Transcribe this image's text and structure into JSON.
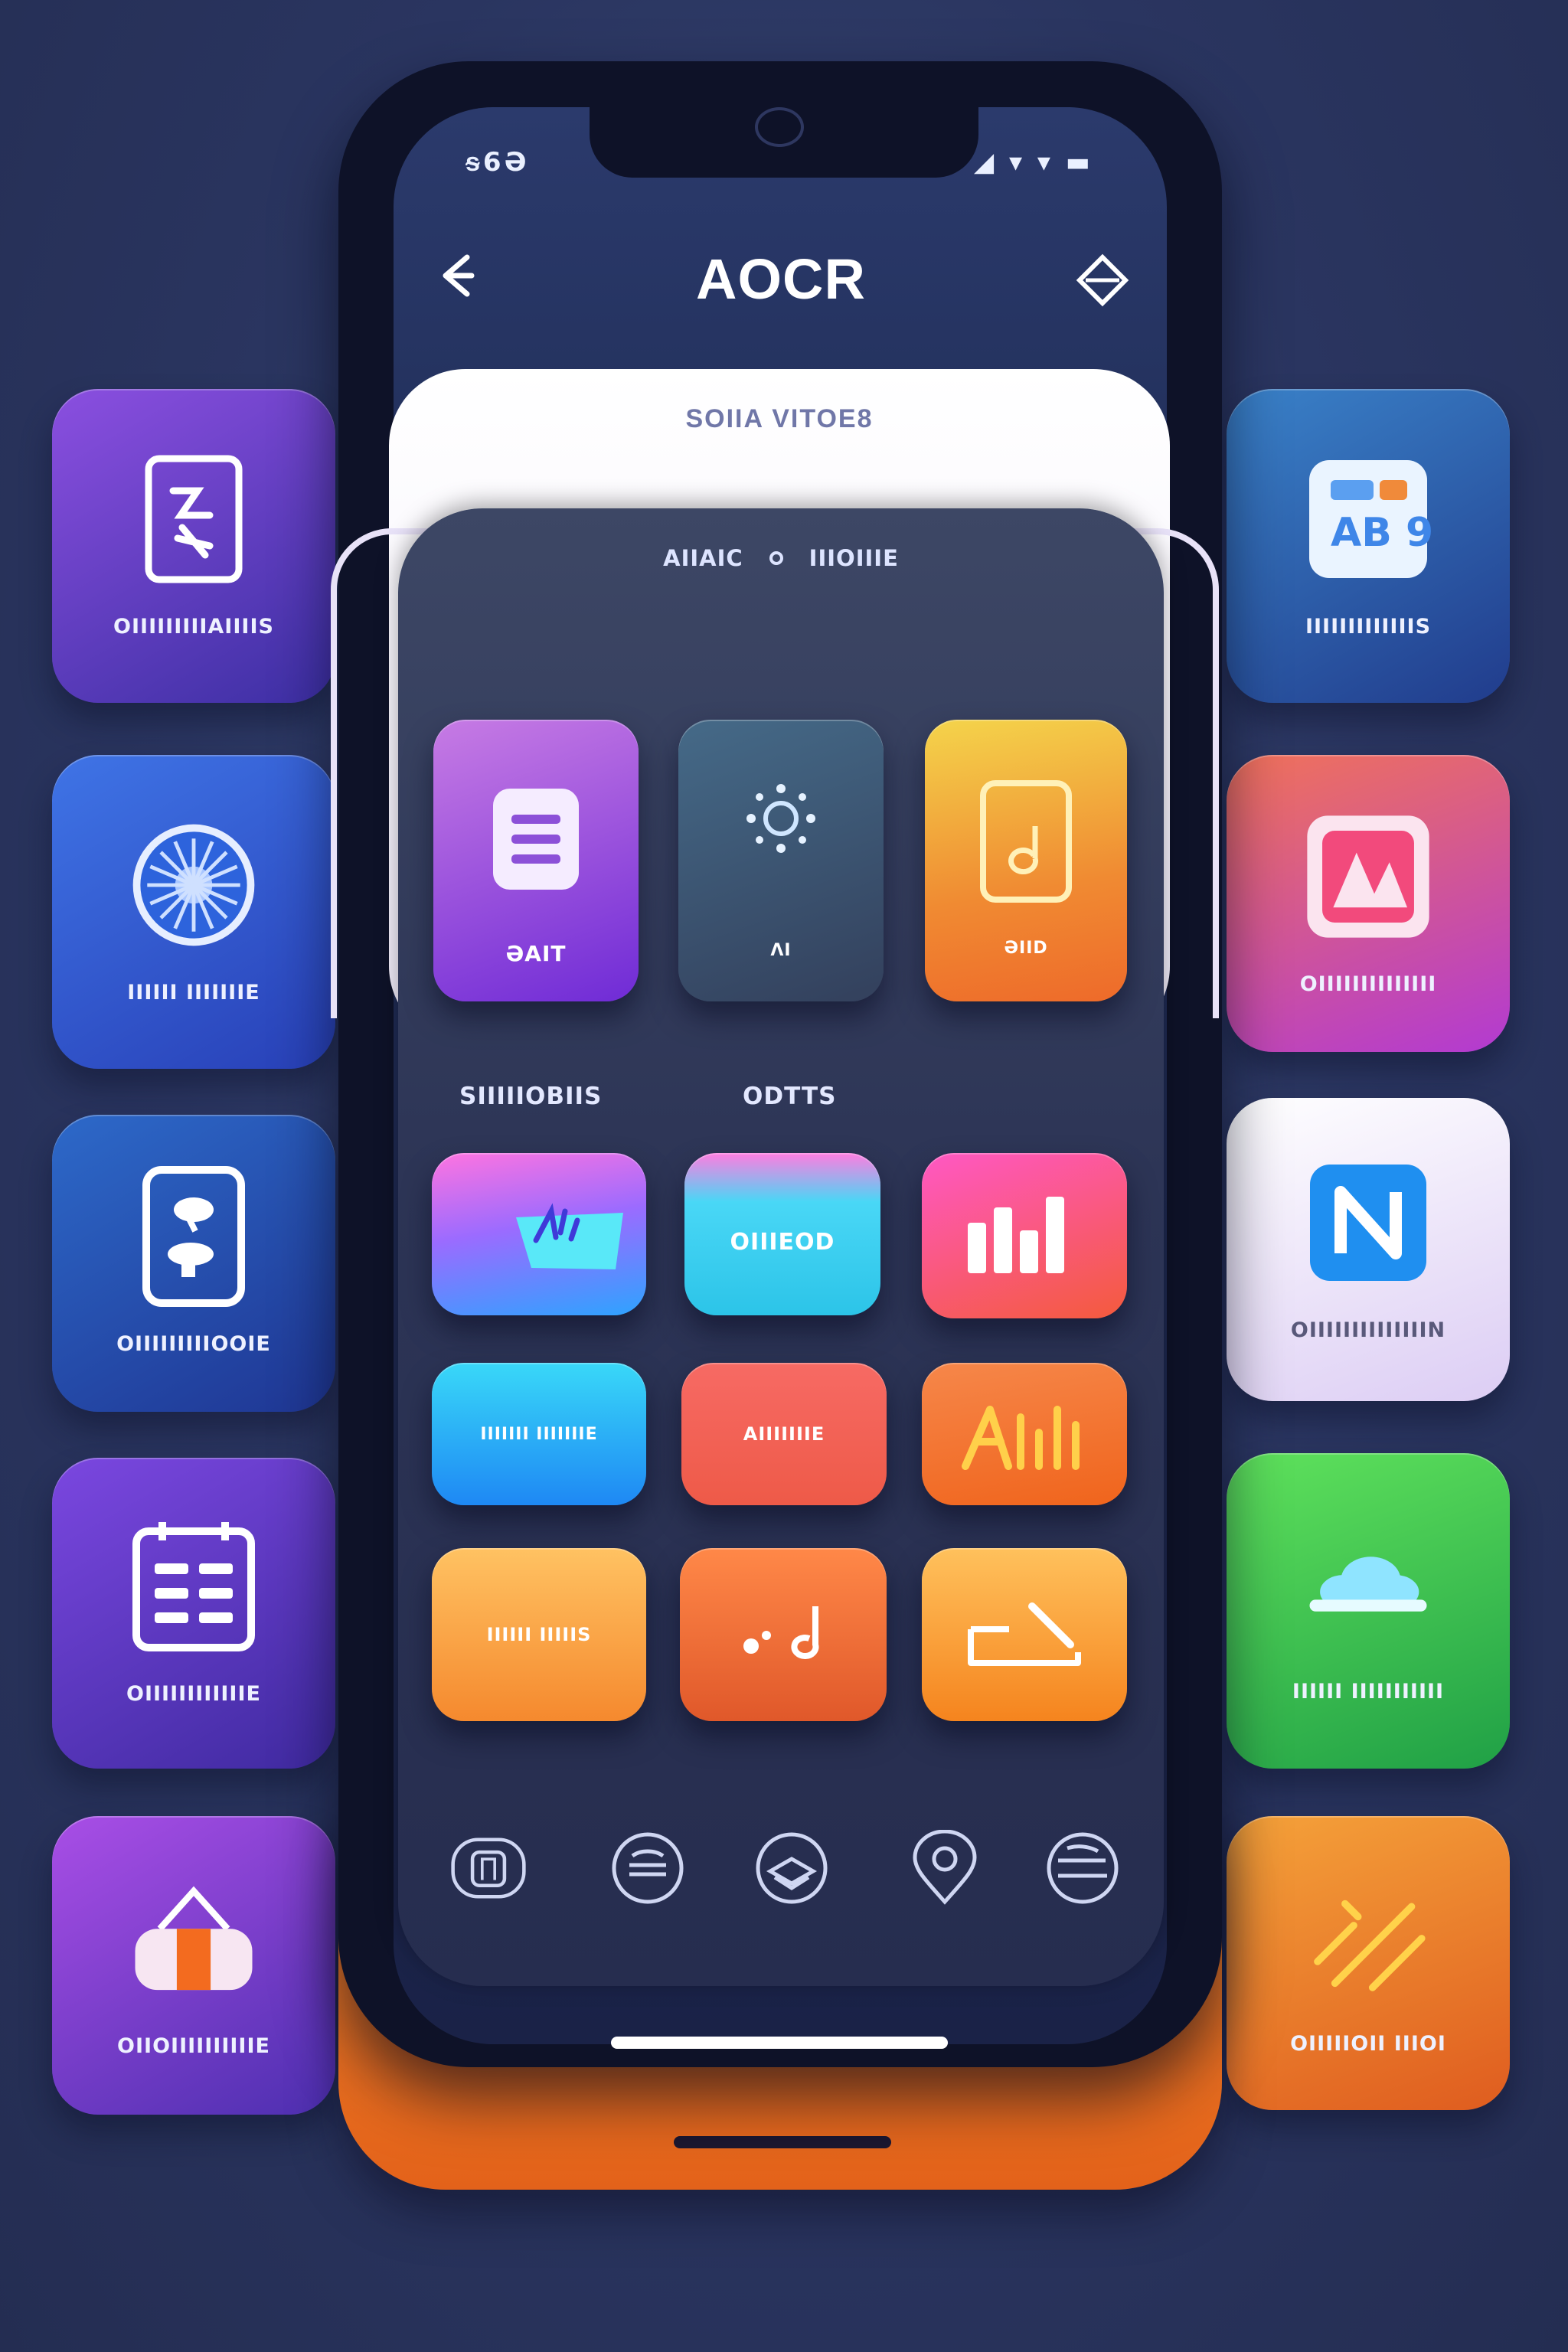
{
  "status_bar": {
    "left": "ᵴ6Ә",
    "right": "◢ ▾ ▾ ▬"
  },
  "header": {
    "title": "AOCR",
    "back_icon": "arrow-left-icon",
    "action_icon": "diamond-icon"
  },
  "sheet": {
    "heading": "SOIIA VITOE8"
  },
  "card_tabs": [
    "AIIAIC",
    "IIIOIIIE"
  ],
  "top_apps": [
    {
      "label": "ƏAIT",
      "icon": "document-icon"
    },
    {
      "label": "ɅI",
      "icon": "sun-dots-icon"
    },
    {
      "label": "ƏIID",
      "icon": "note-card-icon"
    }
  ],
  "sections": [
    "SIIIIIOBIIS",
    "ODTTS"
  ],
  "grid_apps": [
    {
      "label": "",
      "icon": "paper-plane-icon"
    },
    {
      "label": "OIIIEOD",
      "icon": ""
    },
    {
      "label": "",
      "icon": "bar-chart-icon"
    },
    {
      "label": "IIIIIII IIIIIIIE",
      "icon": ""
    },
    {
      "label": "AIIIIIIIE",
      "icon": ""
    },
    {
      "label": "",
      "icon": "bar-chart-outline-icon"
    },
    {
      "label": "IIIIII IIIIIS",
      "icon": ""
    },
    {
      "label": "",
      "icon": "music-note-icon"
    },
    {
      "label": "",
      "icon": "tray-pen-icon"
    }
  ],
  "bottom_nav": [
    "gallery-icon",
    "stack-icon",
    "layers-icon",
    "location-pin-icon",
    "globe-icon"
  ],
  "left_tiles": [
    {
      "label": "OIIIIIIIIIAIIIIS",
      "icon": "scan-doc-icon",
      "color_a": "#8b4fe0",
      "color_b": "#3c2fa3"
    },
    {
      "label": "IIIIII IIIIIIIE",
      "icon": "sunburst-icon",
      "color_a": "#3f74e6",
      "color_b": "#2840b7"
    },
    {
      "label": "OIIIIIIIIIOOIE",
      "icon": "phone-icon",
      "color_a": "#2d69c9",
      "color_b": "#1f3693"
    },
    {
      "label": "OIIIIIIIIIIIIE",
      "icon": "spreadsheet-icon",
      "color_a": "#7b47e0",
      "color_b": "#3f2aa0"
    },
    {
      "label": "OIIOIIIIIIIIIIE",
      "icon": "shopping-bag-icon",
      "color_a": "#a94ee6",
      "color_b": "#4d2fb0"
    }
  ],
  "right_tiles": [
    {
      "label": "IIIIIIIIIIIIIS",
      "icon": "cards-icon",
      "color_a": "#3a82c9",
      "color_b": "#213c8c",
      "light": false
    },
    {
      "label": "OIIIIIIIIIIIIII",
      "icon": "photos-icon",
      "color_a": "#f0725a",
      "color_b": "#b23ad2",
      "light": false
    },
    {
      "label": "OIIIIIIIIIIIIIIN",
      "icon": "n-letter-icon",
      "color_a": "#ffffff",
      "color_b": "#dccdf4",
      "light": true
    },
    {
      "label": "IIIIII IIIIIIIIIII",
      "icon": "cloud-icon",
      "color_a": "#5fe25c",
      "color_b": "#20a046",
      "light": false
    },
    {
      "label": "OIIIIIOII IIIOI",
      "icon": "pencil-ruler-icon",
      "color_a": "#f5a23a",
      "color_b": "#df5c1f",
      "light": false
    }
  ],
  "colors": {
    "background": "#2a3560",
    "accent_orange": "#f07a22",
    "phone_frame": "#0e1228"
  }
}
